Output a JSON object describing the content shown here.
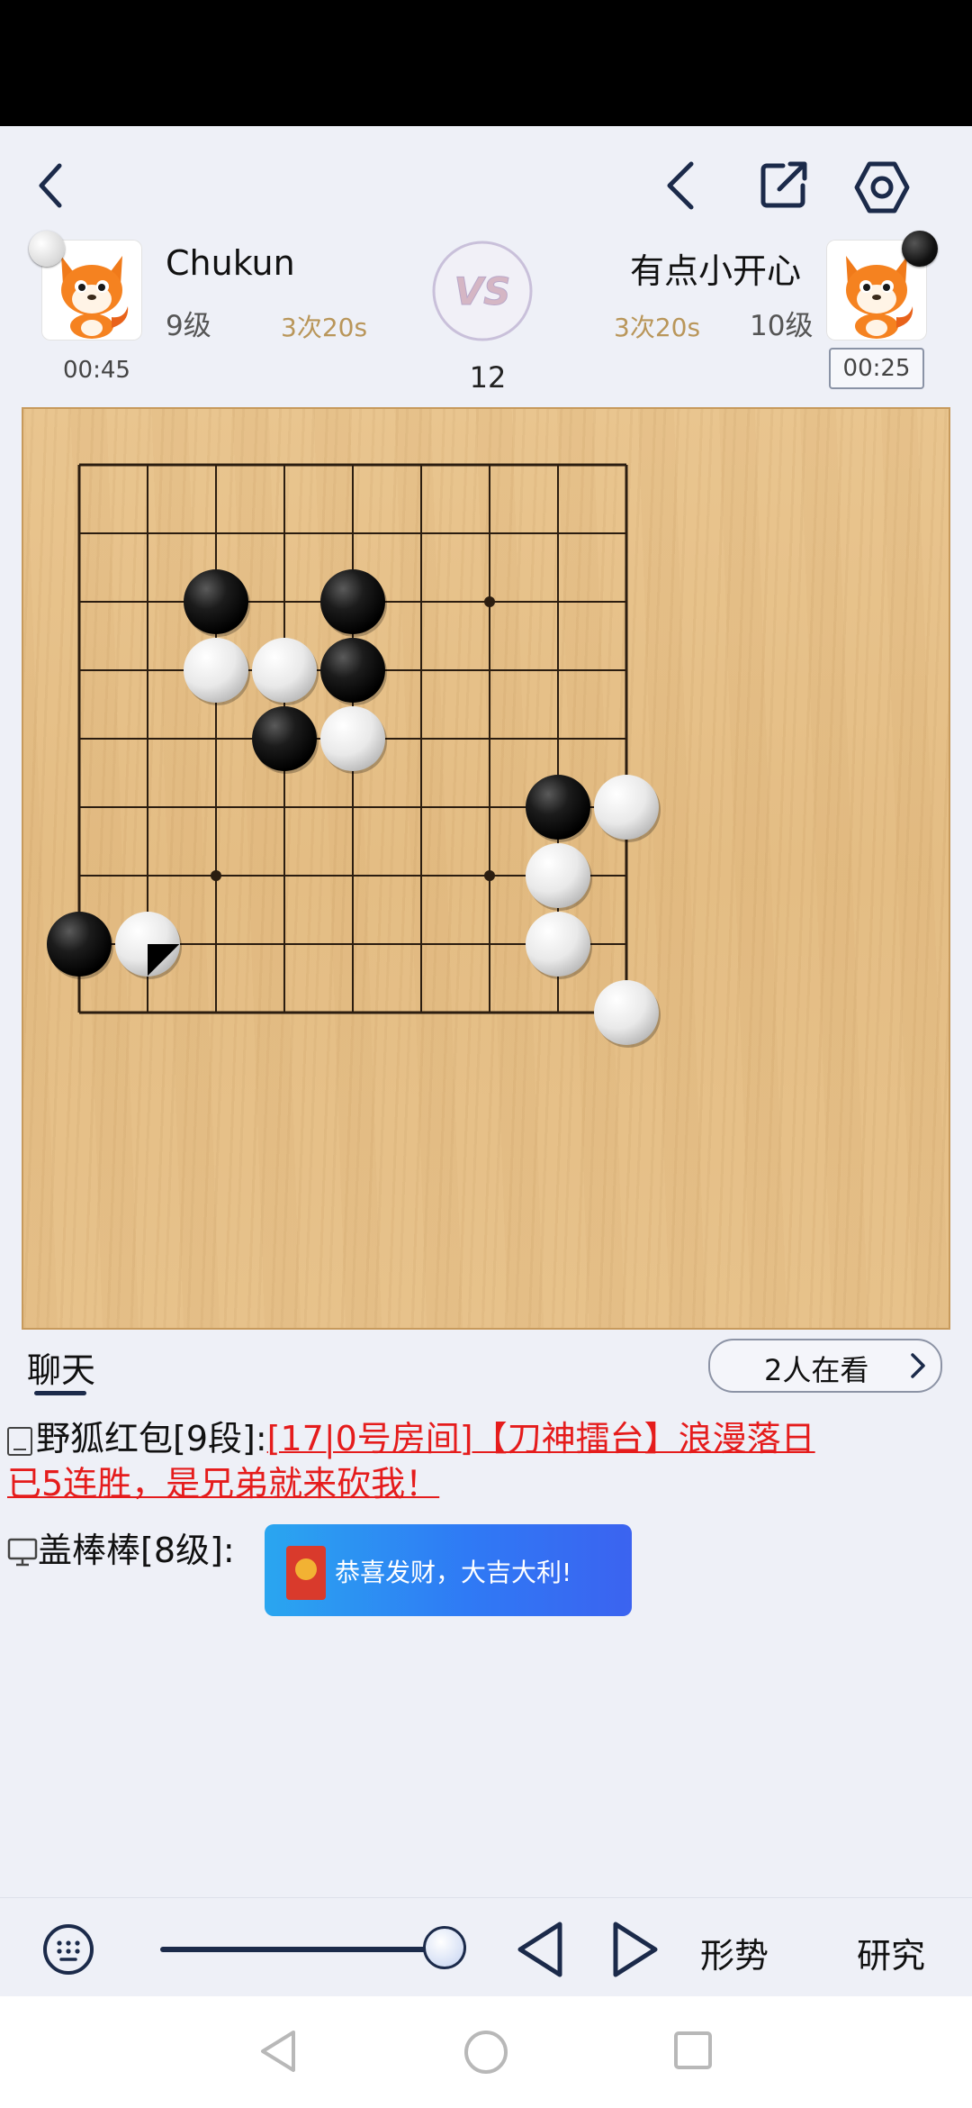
{
  "players": {
    "left": {
      "name": "Chukun",
      "rank": "9级",
      "byoyomi": "3次20s",
      "clock": "00:45",
      "stone": "white"
    },
    "right": {
      "name": "有点小开心",
      "rank": "10级",
      "byoyomi": "3次20s",
      "clock": "00:25",
      "stone": "black"
    }
  },
  "vs_label": "VS",
  "move_number": "12",
  "board": {
    "size": 9,
    "star_points": [
      [
        6,
        2
      ],
      [
        2,
        6
      ],
      [
        6,
        6
      ]
    ],
    "stones": [
      {
        "c": 2,
        "r": 2,
        "color": "black"
      },
      {
        "c": 4,
        "r": 2,
        "color": "black"
      },
      {
        "c": 2,
        "r": 3,
        "color": "white"
      },
      {
        "c": 3,
        "r": 3,
        "color": "white"
      },
      {
        "c": 4,
        "r": 3,
        "color": "black"
      },
      {
        "c": 3,
        "r": 4,
        "color": "black"
      },
      {
        "c": 4,
        "r": 4,
        "color": "white"
      },
      {
        "c": 7,
        "r": 5,
        "color": "black"
      },
      {
        "c": 8,
        "r": 5,
        "color": "white"
      },
      {
        "c": 7,
        "r": 6,
        "color": "white"
      },
      {
        "c": 0,
        "r": 7,
        "color": "black"
      },
      {
        "c": 1,
        "r": 7,
        "color": "white",
        "last_move": true
      },
      {
        "c": 7,
        "r": 7,
        "color": "white"
      },
      {
        "c": 8,
        "r": 8,
        "color": "white"
      }
    ]
  },
  "chat": {
    "tab_label": "聊天",
    "watchers": "2人在看",
    "messages": [
      {
        "sender": "野狐红包[9段]:",
        "text": "[17|0号房间]【刀神擂台】浪漫落日已5连胜，是兄弟就来砍我！"
      },
      {
        "sender": "盖棒棒[8级]:",
        "text": "恭喜发财，大吉大利!"
      }
    ]
  },
  "toolbar": {
    "shape_label": "形势",
    "study_label": "研究",
    "slider_value": 1.0
  }
}
